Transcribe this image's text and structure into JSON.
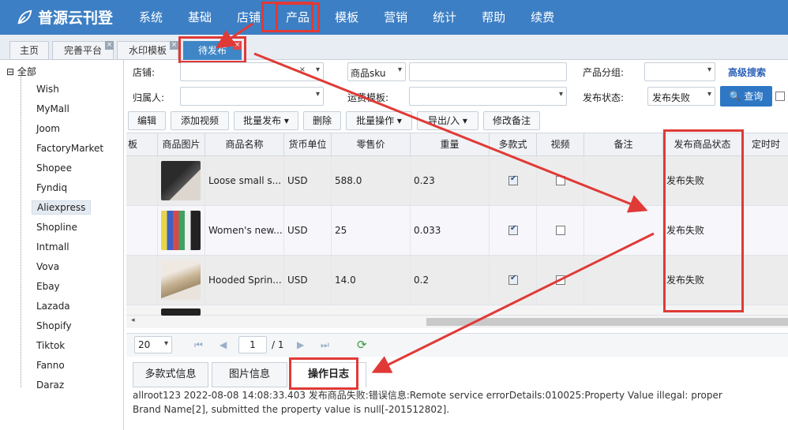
{
  "app": {
    "logo": "普源云刊登"
  },
  "nav": {
    "items": [
      "系统",
      "基础",
      "店铺",
      "产品",
      "模板",
      "营销",
      "统计",
      "帮助",
      "续费"
    ],
    "active": "产品"
  },
  "tabs": [
    {
      "label": "主页"
    },
    {
      "label": "完善平台"
    },
    {
      "label": "水印模板"
    },
    {
      "label": "待发布"
    }
  ],
  "sidebar": {
    "root": "全部",
    "items": [
      "Wish",
      "MyMall",
      "Joom",
      "FactoryMarket",
      "Shopee",
      "Fyndiq",
      "Aliexpress",
      "Shopline",
      "Intmall",
      "Vova",
      "Ebay",
      "Lazada",
      "Shopify",
      "Tiktok",
      "Fanno",
      "Daraz"
    ],
    "selected": "Aliexpress"
  },
  "filters": {
    "store_label": "店铺:",
    "sku_select": "商品sku",
    "product_group_label": "产品分组:",
    "advanced_search": "高级搜索",
    "owner_label": "归属人:",
    "shipping_tpl_label": "运费模板:",
    "publish_status_label": "发布状态:",
    "publish_status_value": "发布失败",
    "query_button": "查询"
  },
  "toolbar": {
    "edit": "编辑",
    "add_video": "添加视频",
    "batch_publish": "批量发布",
    "delete": "删除",
    "batch_ops": "批量操作",
    "import_export": "导出/入",
    "edit_note": "修改备注"
  },
  "table": {
    "columns": [
      "板",
      "商品图片",
      "商品名称",
      "货币单位",
      "零售价",
      "重量",
      "多款式",
      "视频",
      "备注",
      "发布商品状态",
      "定时时"
    ],
    "rows": [
      {
        "name": "Loose small s...",
        "currency": "USD",
        "price": "588.0",
        "weight": "0.23",
        "multi": true,
        "video": false,
        "note": "",
        "status": "发布失败"
      },
      {
        "name": "Women's new...",
        "currency": "USD",
        "price": "25",
        "weight": "0.033",
        "multi": true,
        "video": false,
        "note": "",
        "status": "发布失败"
      },
      {
        "name": "Hooded Sprin...",
        "currency": "USD",
        "price": "14.0",
        "weight": "0.2",
        "multi": true,
        "video": false,
        "note": "",
        "status": "发布失败"
      }
    ]
  },
  "pager": {
    "page_size": "20",
    "page": "1",
    "total": "/ 1"
  },
  "bottom_tabs": [
    "多款式信息",
    "图片信息",
    "操作日志"
  ],
  "log": {
    "line1": "allroot123 2022-08-08 14:08:33.403 发布商品失败:错误信息:Remote service errorDetails:010025:Property Value illegal: proper",
    "line2": "Brand Name[2], submitted the property value is null[-201512802]."
  },
  "colors": {
    "brand": "#3d7fc4",
    "annotation": "#e03a36"
  }
}
